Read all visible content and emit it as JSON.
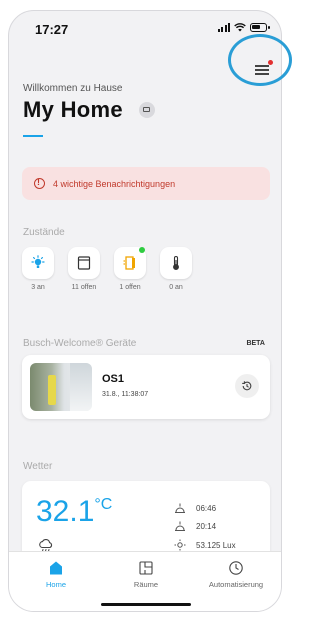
{
  "status_bar": {
    "time": "17:27"
  },
  "header": {
    "welcome": "Willkommen zu Hause",
    "title": "My Home"
  },
  "alert": {
    "text": "4 wichtige Benachrichtigungen"
  },
  "states_section": {
    "title": "Zustände",
    "items": [
      {
        "icon": "light-icon",
        "label": "3 an"
      },
      {
        "icon": "blind-icon",
        "label": "11 offen"
      },
      {
        "icon": "door-icon",
        "label": "1 offen"
      },
      {
        "icon": "thermometer-icon",
        "label": "0 an"
      }
    ]
  },
  "devices_section": {
    "title": "Busch-Welcome® Geräte",
    "badge": "BETA",
    "camera": {
      "name": "OS1",
      "timestamp": "31.8., 11:38:07"
    }
  },
  "weather_section": {
    "title": "Wetter",
    "temperature": "32.1",
    "unit": "°C",
    "sunrise": "06:46",
    "sunset": "20:14",
    "brightness": "53.125 Lux"
  },
  "tabs": [
    {
      "label": "Home",
      "active": true
    },
    {
      "label": "Räume",
      "active": false
    },
    {
      "label": "Automatisierung",
      "active": false
    }
  ],
  "colors": {
    "accent": "#1aa3e8",
    "alert_text": "#c0392b",
    "alert_bg": "#f9e1e1",
    "highlight_ring": "#2a9ed6"
  }
}
